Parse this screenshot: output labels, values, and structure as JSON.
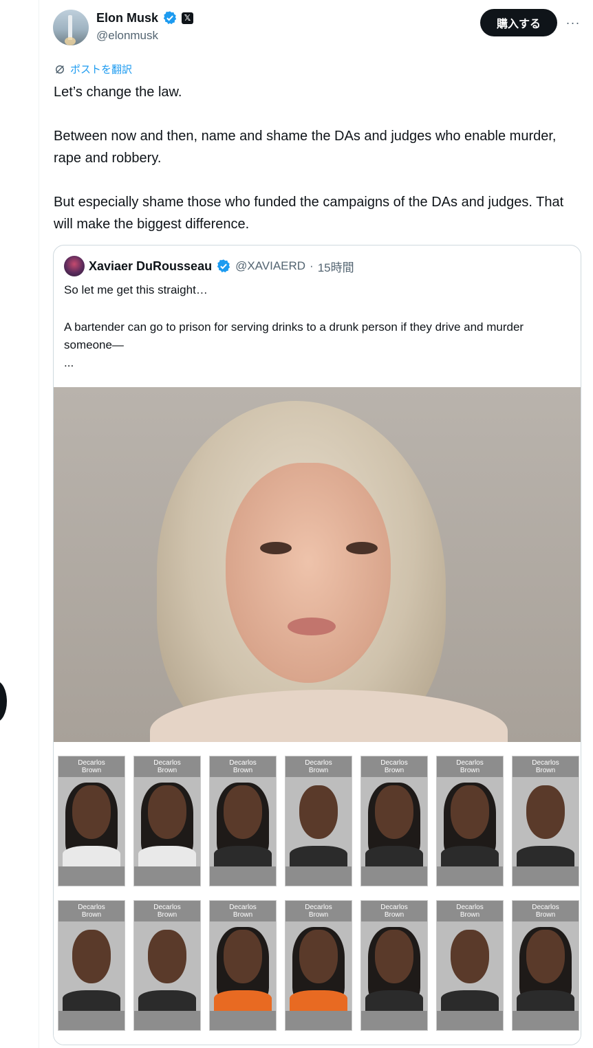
{
  "author": {
    "name": "Elon Musk",
    "handle": "@elonmusk",
    "badge": "𝕏"
  },
  "buttons": {
    "buy_label": "購入する",
    "more_label": "···"
  },
  "translate_label": "ポストを翻訳",
  "tweet": {
    "paragraphs": [
      "Let’s change the law.",
      "Between now and then, name and shame the DAs and judges who enable murder, rape and robbery.",
      "But especially shame those who funded the campaigns of the DAs and judges. That will make the biggest difference."
    ]
  },
  "quote": {
    "name": "Xaviaer DuRousseau",
    "handle": "@XAVIAERD",
    "separator": "·",
    "time": "15時間",
    "lines": [
      "So let me get this straight…",
      "A bartender can go to prison for serving drinks to a drunk person if they drive and murder someone—",
      "..."
    ]
  },
  "mugshot": {
    "caption_line1": "Decarlos",
    "caption_line2": "Brown"
  },
  "colors": {
    "accent": "#1d9bf0",
    "text": "#0f1419",
    "muted": "#536471",
    "border": "#cfd9de"
  },
  "icons": [
    "verified-badge-icon",
    "x-logo-icon",
    "translate-icon",
    "more-icon"
  ]
}
